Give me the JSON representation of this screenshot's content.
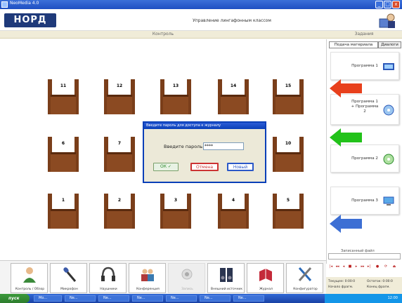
{
  "window": {
    "title": "NeoMedia 4.0"
  },
  "header": {
    "logo_text": "НОРД",
    "app_title": "Управление лингафонным классом"
  },
  "sections": {
    "control": "Контроль",
    "tasks": "Задания"
  },
  "desks": [
    {
      "num": "11"
    },
    {
      "num": "12"
    },
    {
      "num": "13"
    },
    {
      "num": "14"
    },
    {
      "num": "15"
    },
    {
      "num": "6"
    },
    {
      "num": "7"
    },
    {
      "num": "10"
    },
    {
      "num": "1"
    },
    {
      "num": "2"
    },
    {
      "num": "3"
    },
    {
      "num": "4"
    },
    {
      "num": "5"
    }
  ],
  "right_panel": {
    "tabs": [
      "Подача материала",
      "Диалоги"
    ],
    "programs": [
      {
        "label": "Программа 1"
      },
      {
        "label": "Программа 1 + Программа 2"
      },
      {
        "label": "Программа 2"
      },
      {
        "label": "Программа 3"
      }
    ],
    "file_label": "Записанный файл",
    "arrow_colors": {
      "red": "#e8401c",
      "green": "#22c21a",
      "blue": "#3d6fd4"
    }
  },
  "toolbar": {
    "items": [
      {
        "label": "Контроль / Обзор",
        "icon": "user-icon"
      },
      {
        "label": "Микрофон",
        "icon": "microphone-icon"
      },
      {
        "label": "Наушники",
        "icon": "headphones-icon"
      },
      {
        "label": "Конференция",
        "icon": "conference-icon"
      },
      {
        "label": "Запись",
        "icon": "record-icon"
      },
      {
        "label": "Внешний источник",
        "icon": "speaker-icon"
      },
      {
        "label": "Журнал",
        "icon": "book-icon"
      },
      {
        "label": "Конфигуратор",
        "icon": "tools-icon"
      }
    ]
  },
  "status": {
    "line1": "Текущее: 0:00:0",
    "line2": "Остаток: 0:00:0",
    "line3": "Начало фрагм.",
    "line4": "Конец фрагм."
  },
  "dialog": {
    "title": "Введите пароль для доступа к журналу",
    "label": "Введите пароль",
    "password_value": "****",
    "ok_label": "ОК",
    "cancel_label": "Отмена",
    "new_label": "Новый"
  },
  "taskbar": {
    "start_label": "пуск",
    "tasks": [
      "Мо...",
      "Ne...",
      "Ne...",
      "Ne...",
      "Ne...",
      "Ne...",
      "Ne..."
    ],
    "time": "12:00"
  }
}
